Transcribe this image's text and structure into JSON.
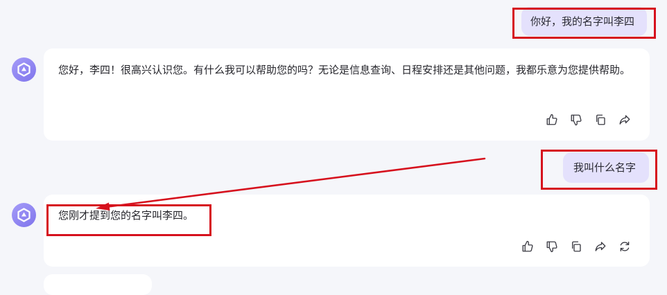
{
  "conversation": {
    "user_message_1": "你好，我的名字叫李四",
    "assistant_reply_1": "您好，李四！很高兴认识您。有什么我可以帮助您的吗？无论是信息查询、日程安排还是其他问题，我都乐意为您提供帮助。",
    "user_message_2": "我叫什么名字",
    "assistant_reply_2": "您刚才提到您的名字叫李四。"
  },
  "icons": {
    "avatar": "assistant-logo-icon",
    "like": "thumbs-up-icon",
    "dislike": "thumbs-down-icon",
    "copy": "copy-icon",
    "share": "share-icon",
    "regenerate": "refresh-icon"
  },
  "colors": {
    "annotation": "#d6111d",
    "user_bubble": "#e4e1fc",
    "avatar": "#8c82f0",
    "background": "#f5f6fa"
  }
}
